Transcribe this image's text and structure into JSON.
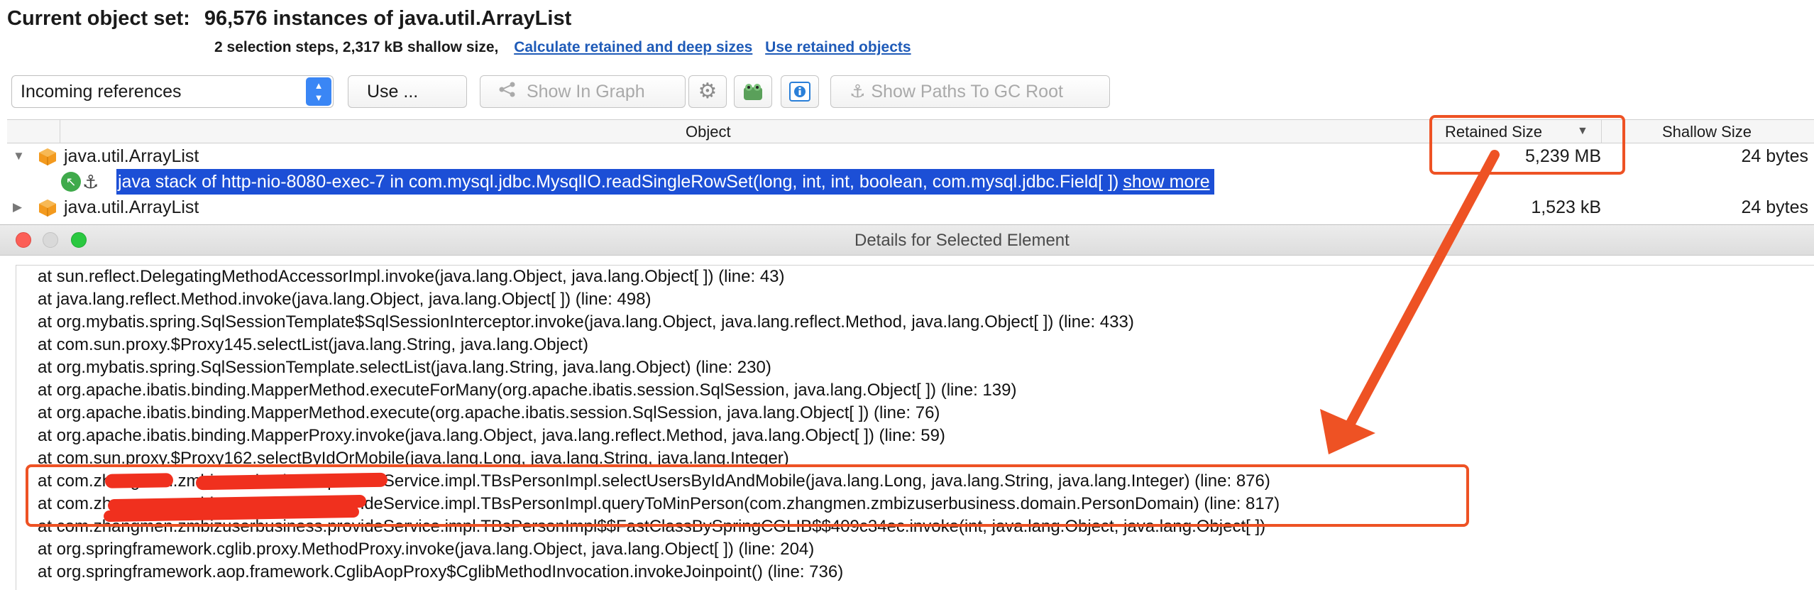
{
  "header": {
    "label": "Current object set:",
    "summary": "96,576 instances of java.util.ArrayList",
    "steps": "2 selection steps, 2,317 kB shallow size,",
    "link_retained": "Calculate retained and deep sizes",
    "link_use_retained": "Use retained objects"
  },
  "toolbar": {
    "combo_value": "Incoming references",
    "use_label": "Use ...",
    "show_in_graph": "Show In Graph",
    "show_paths": "Show Paths To GC Root"
  },
  "table": {
    "columns": {
      "object": "Object",
      "retained": "Retained Size",
      "shallow": "Shallow Size"
    },
    "rows": [
      {
        "name": "java.util.ArrayList",
        "retained": "5,239 MB",
        "shallow": "24 bytes",
        "expanded": true
      },
      {
        "name": "java.util.ArrayList",
        "retained": "1,523 kB",
        "shallow": "24 bytes",
        "expanded": false
      }
    ],
    "child": {
      "text": "java stack of http-nio-8080-exec-7 in com.mysql.jdbc.MysqlIO.readSingleRowSet(long, int, int, boolean, com.mysql.jdbc.Field[ ])",
      "more": "show more"
    }
  },
  "details": {
    "title": "Details for Selected Element",
    "frames": [
      "at sun.reflect.DelegatingMethodAccessorImpl.invoke(java.lang.Object, java.lang.Object[ ]) (line: 43)",
      "at java.lang.reflect.Method.invoke(java.lang.Object, java.lang.Object[ ]) (line: 498)",
      "at org.mybatis.spring.SqlSessionTemplate$SqlSessionInterceptor.invoke(java.lang.Object, java.lang.reflect.Method, java.lang.Object[ ]) (line: 433)",
      "at com.sun.proxy.$Proxy145.selectList(java.lang.String, java.lang.Object)",
      "at org.mybatis.spring.SqlSessionTemplate.selectList(java.lang.String, java.lang.Object) (line: 230)",
      "at org.apache.ibatis.binding.MapperMethod.executeForMany(org.apache.ibatis.session.SqlSession, java.lang.Object[ ]) (line: 139)",
      "at org.apache.ibatis.binding.MapperMethod.execute(org.apache.ibatis.session.SqlSession, java.lang.Object[ ]) (line: 76)",
      "at org.apache.ibatis.binding.MapperProxy.invoke(java.lang.Object, java.lang.reflect.Method, java.lang.Object[ ]) (line: 59)",
      "at com.sun.proxy.$Proxy162.selectByIdOrMobile(java.lang.Long, java.lang.String, java.lang.Integer)",
      "at com.zhangmen.zmbizuserbusiness.provideService.impl.TBsPersonImpl.selectUsersByIdAndMobile(java.lang.Long, java.lang.String, java.lang.Integer) (line: 876)",
      "at com.zhangmen.zmbizuserbusiness.provideService.impl.TBsPersonImpl.queryToMinPerson(com.zhangmen.zmbizuserbusiness.domain.PersonDomain) (line: 817)",
      "at com.zhangmen.zmbizuserbusiness.provideService.impl.TBsPersonImpl$$FastClassBySpringCGLIB$$409c34ec.invoke(int, java.lang.Object, java.lang.Object[ ])",
      "at org.springframework.cglib.proxy.MethodProxy.invoke(java.lang.Object, java.lang.Object[ ]) (line: 204)",
      "at org.springframework.aop.framework.CglibAopProxy$CglibMethodInvocation.invokeJoinpoint() (line: 736)"
    ]
  },
  "colors": {
    "annotation": "#ee5224",
    "selection": "#1c4fd6",
    "link": "#1f5bb8"
  },
  "icons": [
    "cube-icon",
    "gc-root-icon",
    "anchor-icon",
    "gear-icon",
    "frog-icon",
    "info-icon",
    "graph-icon"
  ]
}
